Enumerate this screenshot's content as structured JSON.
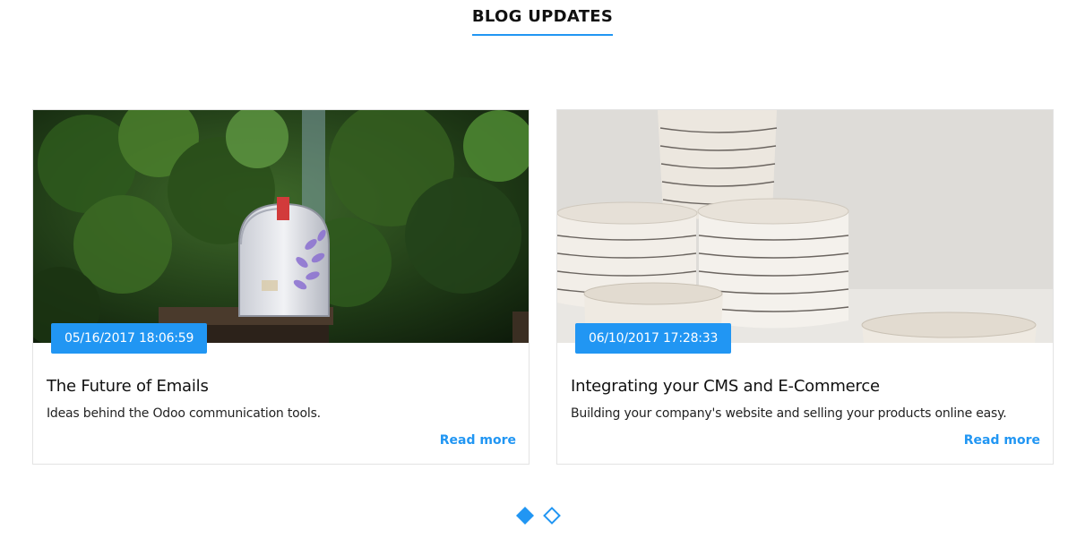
{
  "section": {
    "title": "BLOG UPDATES"
  },
  "posts": [
    {
      "date": "05/16/2017 18:06:59",
      "title": "The Future of Emails",
      "description": "Ideas behind the Odoo communication tools.",
      "read_more": "Read more",
      "image": "mailbox-photo"
    },
    {
      "date": "06/10/2017 17:28:33",
      "title": "Integrating your CMS and E-Commerce",
      "description": "Building your company's website and selling your products online easy.",
      "read_more": "Read more",
      "image": "ceramic-cups-photo"
    }
  ],
  "carousel": {
    "slides": 2,
    "active": 1
  },
  "colors": {
    "accent": "#2196f3",
    "text": "#111111"
  }
}
